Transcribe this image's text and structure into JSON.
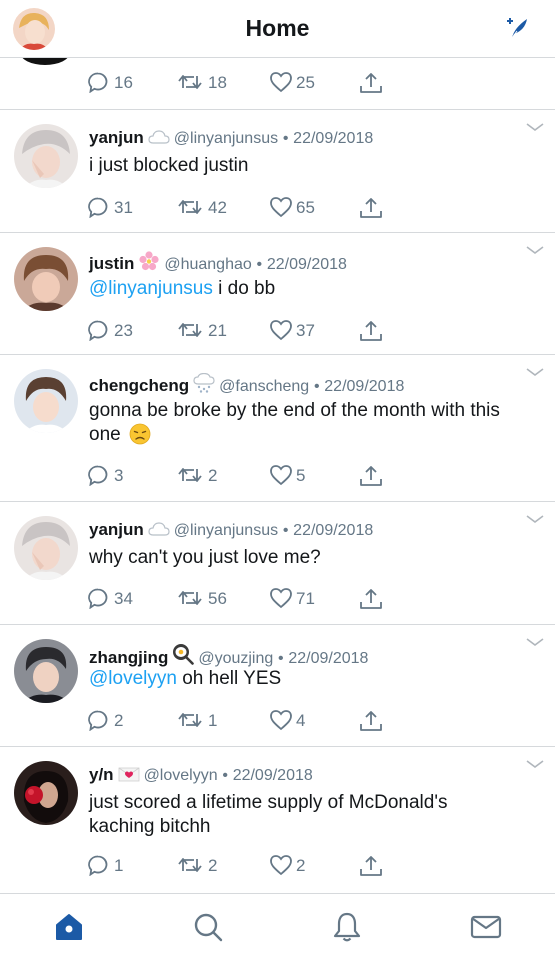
{
  "header": {
    "title": "Home"
  },
  "partial_tweet": {
    "replies": "16",
    "retweets": "18",
    "likes": "25"
  },
  "tweets": [
    {
      "name": "yanjun",
      "handle": "@linyanjunsus",
      "dot": "•",
      "date": "22/09/2018",
      "mention": "",
      "text": "i just blocked justin",
      "text2": "",
      "replies": "31",
      "retweets": "42",
      "likes": "65"
    },
    {
      "name": "justin",
      "handle": "@huanghao",
      "dot": "•",
      "date": "22/09/2018",
      "mention": "@linyanjunsus",
      "text": " i do bb",
      "text2": "",
      "replies": "23",
      "retweets": "21",
      "likes": "37"
    },
    {
      "name": "chengcheng",
      "handle": "@fanscheng",
      "dot": "•",
      "date": "22/09/2018",
      "mention": "",
      "text": "gonna be broke by the end of the month with this",
      "text2": "one",
      "replies": "3",
      "retweets": "2",
      "likes": "5"
    },
    {
      "name": "yanjun",
      "handle": "@linyanjunsus",
      "dot": "•",
      "date": "22/09/2018",
      "mention": "",
      "text": "why can't you just love me?",
      "text2": "",
      "replies": "34",
      "retweets": "56",
      "likes": "71"
    },
    {
      "name": "zhangjing",
      "handle": "@youzjing",
      "dot": "•",
      "date": "22/09/2018",
      "mention": "@lovelyyn",
      "text": " oh hell YES",
      "text2": "",
      "replies": "2",
      "retweets": "1",
      "likes": "4"
    },
    {
      "name": "y/n",
      "handle": "@lovelyyn",
      "dot": "•",
      "date": "22/09/2018",
      "mention": "",
      "text": "just scored a lifetime supply of McDonald's",
      "text2": "kaching bitchh",
      "replies": "1",
      "retweets": "2",
      "likes": "2"
    }
  ],
  "colors": {
    "accent": "#1da1f2",
    "nav_active": "#1c5aa6",
    "secondary_text": "#657786",
    "divider": "#d6d9dc"
  },
  "icons": {
    "reply": "reply-icon",
    "retweet": "retweet-icon",
    "like": "heart-icon",
    "share": "share-icon",
    "home": "home-icon",
    "search": "search-icon",
    "notifications": "bell-icon",
    "messages": "mail-icon"
  }
}
